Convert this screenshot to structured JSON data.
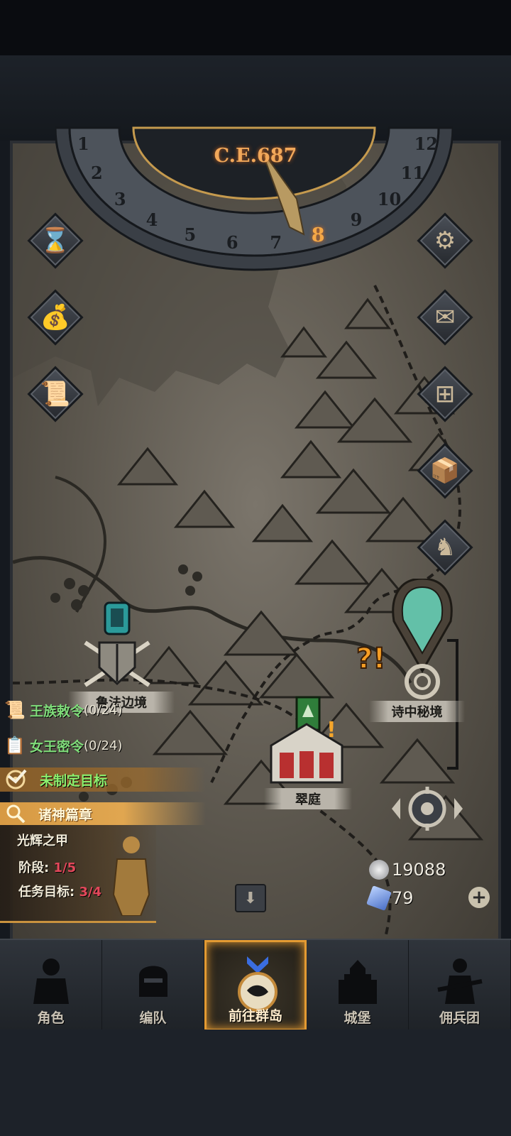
{
  "calendar": {
    "year": "C.E.687",
    "months": [
      "1",
      "2",
      "3",
      "4",
      "5",
      "6",
      "7",
      "8",
      "9",
      "10",
      "11",
      "12"
    ],
    "current_month": "8"
  },
  "left_buttons": [
    {
      "name": "hourglass-button",
      "icon": "hourglass-icon",
      "glyph": "⌛"
    },
    {
      "name": "money-bag-button",
      "icon": "money-bag-icon",
      "glyph": "💰"
    },
    {
      "name": "scroll-button",
      "icon": "scroll-icon",
      "glyph": "📜"
    }
  ],
  "right_buttons": [
    {
      "name": "settings-button",
      "icon": "gear-icon",
      "glyph": "⚙"
    },
    {
      "name": "mail-button",
      "icon": "envelope-icon",
      "glyph": "✉"
    },
    {
      "name": "window-button",
      "icon": "window-icon",
      "glyph": "⊞"
    },
    {
      "name": "supplies-button",
      "icon": "crate-icon",
      "glyph": "📦"
    },
    {
      "name": "knight-button",
      "icon": "knight-helmet-icon",
      "glyph": "♞"
    }
  ],
  "locations": {
    "left_keep": "鲁法边境",
    "poem_realm": "诗中秘境",
    "green_court": "翠庭"
  },
  "quests": [
    {
      "title": "王族敕令",
      "progress": "(0/24)",
      "icon": "royal-decree-scroll-icon"
    },
    {
      "title": "女王密令",
      "progress": "(0/24)",
      "icon": "queen-secret-order-icon"
    }
  ],
  "goal": {
    "label": "未制定目标",
    "icon": "target-icon"
  },
  "chapter": {
    "title": "诸神篇章",
    "icon": "search-icon",
    "subtitle": "光辉之甲",
    "stage_label": "阶段: ",
    "stage_value": "1/5",
    "target_label": "任务目标: ",
    "target_value": "3/4"
  },
  "resources": {
    "silver": "19088",
    "crystal": "79"
  },
  "nav": [
    {
      "label": "角色",
      "icon": "character-knight-icon"
    },
    {
      "label": "编队",
      "icon": "formation-helmet-icon"
    },
    {
      "label": "前往群岛",
      "icon": "islands-compass-icon"
    },
    {
      "label": "城堡",
      "icon": "castle-icon"
    },
    {
      "label": "佣兵团",
      "icon": "mercenary-icon"
    }
  ],
  "colors": {
    "accent_orange": "#e39a32",
    "quest_green": "#7fdc7a",
    "stage_red": "#e2475a",
    "year_orange": "#f1a85a"
  }
}
